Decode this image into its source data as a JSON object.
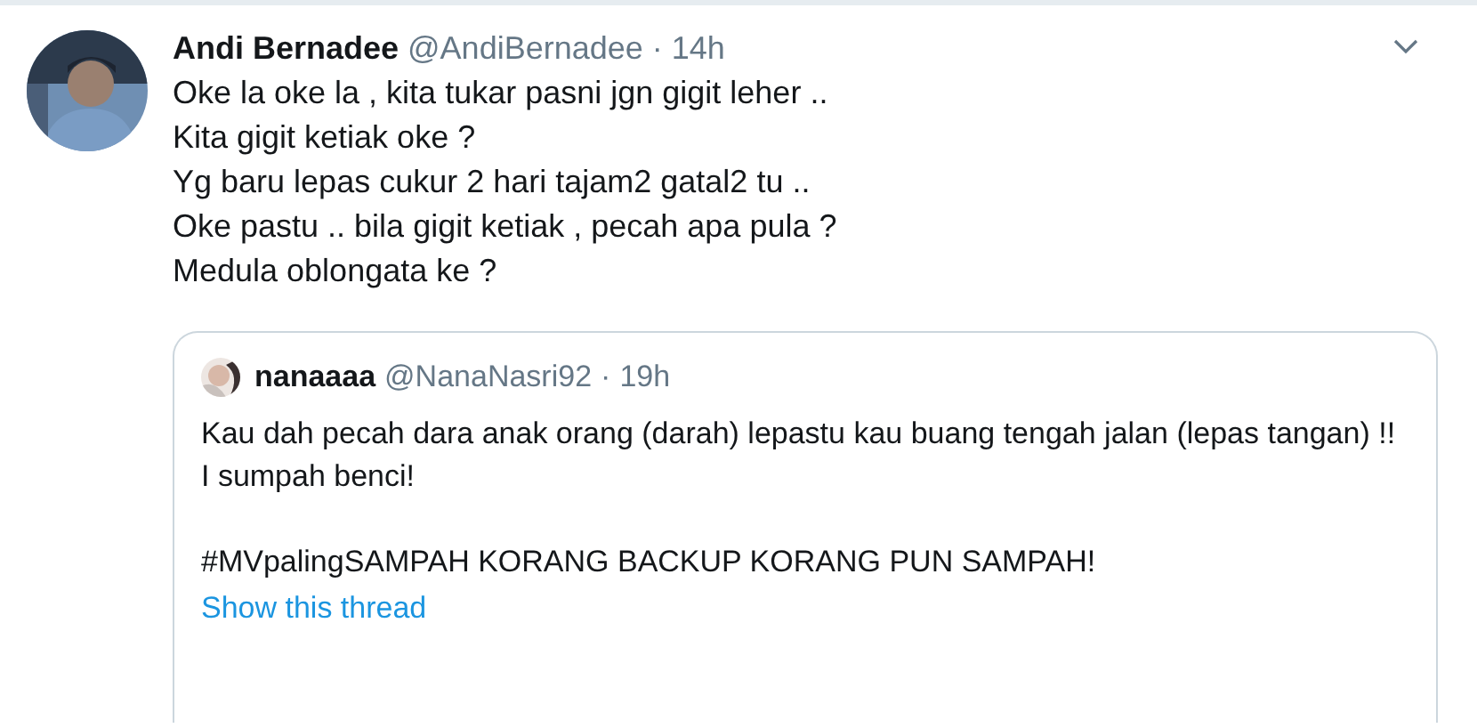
{
  "tweet": {
    "name": "Andi Bernadee",
    "handle": "@AndiBernadee",
    "separator": "·",
    "time": "14h",
    "text": "Oke la oke la , kita tukar pasni jgn gigit leher ..\nKita gigit ketiak oke ?\nYg baru lepas cukur 2 hari tajam2 gatal2 tu ..\nOke pastu .. bila gigit ketiak , pecah apa pula ?\nMedula oblongata ke ?",
    "quote": {
      "name": "nanaaaa",
      "handle": "@NanaNasri92",
      "separator": "·",
      "time": "19h",
      "paragraphs": [
        "Kau dah pecah dara anak orang (darah) lepastu kau buang tengah jalan (lepas tangan) !! I sumpah benci!",
        "#MVpalingSAMPAH KORANG BACKUP KORANG PUN SAMPAH!"
      ],
      "link": "Show this thread"
    }
  }
}
